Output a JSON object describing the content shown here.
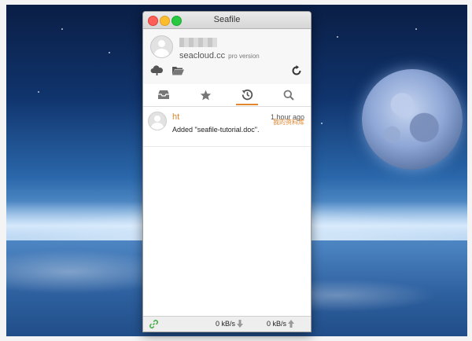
{
  "window": {
    "title": "Seafile"
  },
  "account": {
    "name": "",
    "server": "seacloud.cc",
    "edition": "pro version"
  },
  "toolbar": {
    "icons": [
      "cloud-upload-icon",
      "folder-icon",
      "refresh-icon"
    ]
  },
  "tabs": [
    {
      "id": "libraries",
      "icon": "inbox-tray-icon",
      "active": false
    },
    {
      "id": "starred",
      "icon": "star-icon",
      "active": false
    },
    {
      "id": "activities",
      "icon": "history-clock-icon",
      "active": true
    },
    {
      "id": "search",
      "icon": "search-icon",
      "active": false
    }
  ],
  "events": [
    {
      "user": "ht",
      "time": "1 hour ago",
      "description": "Added \"seafile-tutorial.doc\".",
      "repo": "我的资料库"
    }
  ],
  "status": {
    "download_rate": "0 kB/s",
    "upload_rate": "0 kB/s"
  },
  "colors": {
    "accent": "#e2862f",
    "connected": "#4caf50"
  }
}
